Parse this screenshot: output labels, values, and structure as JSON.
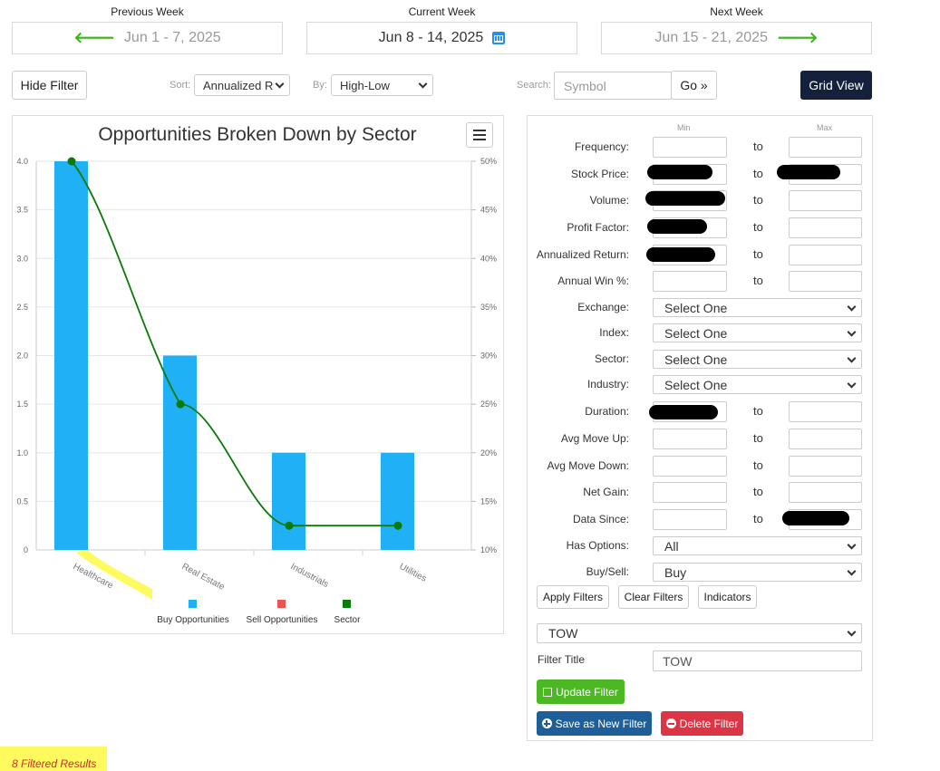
{
  "week_nav": {
    "previous": {
      "label": "Previous Week",
      "range": "Jun 1 - 7, 2025",
      "icon": "arrow-left-icon"
    },
    "current": {
      "label": "Current Week",
      "range": "Jun 8 - 14, 2025",
      "icon": "calendar-icon"
    },
    "next": {
      "label": "Next Week",
      "range": "Jun 15 - 21, 2025",
      "icon": "arrow-right-icon"
    }
  },
  "toolbar": {
    "hide_filter": "Hide Filter",
    "sort_label": "Sort:",
    "sort_value": "Annualized R",
    "by_label": "By:",
    "by_value": "High-Low",
    "search_label": "Search:",
    "search_placeholder": "Symbol",
    "go": "Go »",
    "grid_view": "Grid View"
  },
  "chart_data": {
    "type": "bar",
    "title": "Opportunities Broken Down by Sector",
    "categories": [
      "Healthcare",
      "Real Estate",
      "Industrials",
      "Utilities"
    ],
    "series": [
      {
        "name": "Buy Opportunities",
        "type": "bar",
        "axis": "left",
        "values": [
          4,
          2,
          1,
          1
        ],
        "color": "#1fb0f5"
      },
      {
        "name": "Sell Opportunities",
        "type": "bar",
        "axis": "left",
        "values": [
          0,
          0,
          0,
          0
        ],
        "color": "#ef5350"
      },
      {
        "name": "Sector",
        "type": "line",
        "axis": "right",
        "values": [
          50,
          25,
          12.5,
          12.5
        ],
        "color": "#0a7a0a"
      }
    ],
    "y_left": {
      "min": 0,
      "max": 4,
      "ticks": [
        "0",
        "0.5",
        "1.0",
        "1.5",
        "2.0",
        "2.5",
        "3.0",
        "3.5",
        "4.0"
      ]
    },
    "y_right": {
      "min": 10,
      "max": 50,
      "ticks": [
        "10%",
        "15%",
        "20%",
        "25%",
        "30%",
        "35%",
        "40%",
        "45%",
        "50%"
      ]
    },
    "grid": true,
    "legend_position": "bottom"
  },
  "filters": {
    "min_header": "Min",
    "max_header": "Max",
    "to": "to",
    "ranges": [
      {
        "label": "Frequency:"
      },
      {
        "label": "Stock Price:"
      },
      {
        "label": "Volume:"
      },
      {
        "label": "Profit Factor:"
      },
      {
        "label": "Annualized Return:"
      },
      {
        "label": "Annual Win %:"
      }
    ],
    "selects": [
      {
        "label": "Exchange:",
        "value": "Select One"
      },
      {
        "label": "Index:",
        "value": "Select One"
      },
      {
        "label": "Sector:",
        "value": "Select One"
      },
      {
        "label": "Industry:",
        "value": "Select One"
      }
    ],
    "ranges2": [
      {
        "label": "Duration:"
      },
      {
        "label": "Avg Move Up:"
      },
      {
        "label": "Avg Move Down:"
      },
      {
        "label": "Net Gain:"
      },
      {
        "label": "Data Since:"
      }
    ],
    "has_options": {
      "label": "Has Options:",
      "value": "All"
    },
    "buy_sell": {
      "label": "Buy/Sell:",
      "value": "Buy"
    },
    "apply": "Apply Filters",
    "clear": "Clear Filters",
    "indicators": "Indicators",
    "saved_filter": "TOW",
    "filter_title_label": "Filter Title",
    "filter_title_value": "TOW",
    "update": "Update Filter",
    "save_new": "Save as New Filter",
    "delete": "Delete Filter",
    "colors": {
      "update": "#4cb824",
      "save": "#1f5f99",
      "delete": "#dc3545",
      "grid_view": "#14213d"
    }
  },
  "results": {
    "text": "8 Filtered Results"
  }
}
